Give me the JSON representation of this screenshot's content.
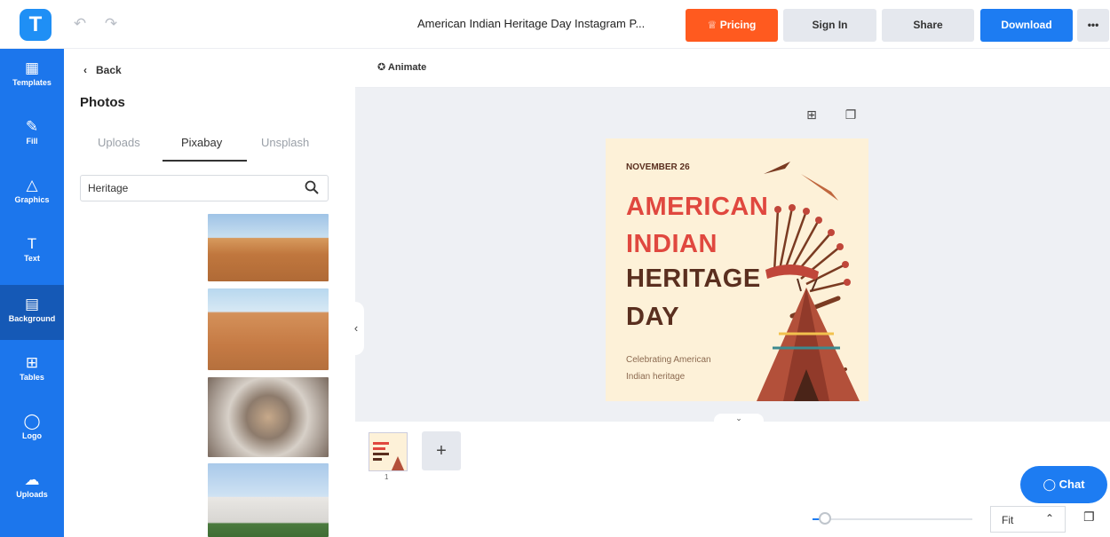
{
  "app": {
    "logo_letter": "T",
    "doc_title": "American Indian Heritage Day Instagram P...",
    "pricing_label": "Pricing",
    "signin_label": "Sign In",
    "share_label": "Share",
    "download_label": "Download",
    "more_label": "•••"
  },
  "rail": [
    {
      "label": "Templates",
      "icon": "templates-icon"
    },
    {
      "label": "Fill",
      "icon": "brush-icon"
    },
    {
      "label": "Graphics",
      "icon": "shapes-icon"
    },
    {
      "label": "Text",
      "icon": "text-icon"
    },
    {
      "label": "Background",
      "icon": "background-icon"
    },
    {
      "label": "Tables",
      "icon": "table-icon"
    },
    {
      "label": "Logo",
      "icon": "logo-icon"
    },
    {
      "label": "Uploads",
      "icon": "cloud-upload-icon"
    }
  ],
  "panel": {
    "back_label": "Back",
    "title": "Photos",
    "tabs": [
      "Uploads",
      "Pixabay",
      "Unsplash"
    ],
    "active_tab": "Pixabay",
    "search_value": "Heritage"
  },
  "toolbar": {
    "animate_label": "Animate"
  },
  "design": {
    "date": "NOVEMBER 26",
    "line1": "AMERICAN",
    "line2": "INDIAN",
    "line3": "HERITAGE",
    "line4": "DAY",
    "sub1": "Celebrating American",
    "sub2": "Indian heritage",
    "colors": {
      "bg": "#fdf1d8",
      "red": "#e0483f",
      "brown": "#5a2f1f"
    }
  },
  "bottom": {
    "page_number": "1",
    "chat_label": "Chat",
    "zoom_label": "Fit"
  }
}
